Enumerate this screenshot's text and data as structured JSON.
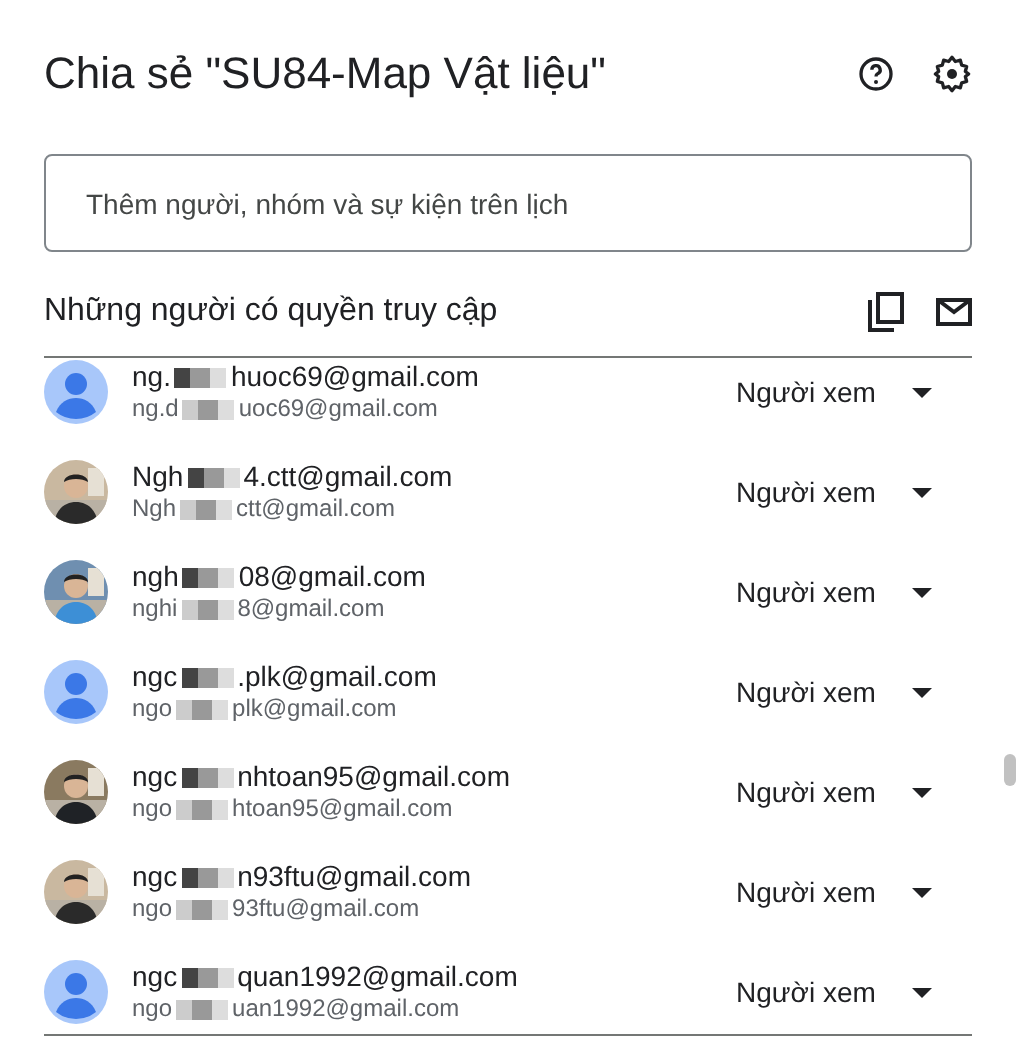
{
  "dialog": {
    "title": "Chia sẻ \"SU84-Map Vật liệu\""
  },
  "add_people": {
    "placeholder": "Thêm người, nhóm và sự kiện trên lịch"
  },
  "access_section": {
    "heading": "Những người có quyền truy cập"
  },
  "people": [
    {
      "kind": "default",
      "name_start": "ng.",
      "name_end": "huoc69@gmail.com",
      "email_start": "ng.d",
      "email_end": "uoc69@gmail.com",
      "role": "Người xem"
    },
    {
      "kind": "picture",
      "name_start": "Ngh",
      "name_end": "4.ctt@gmail.com",
      "email_start": "Ngh",
      "email_end": "ctt@gmail.com",
      "role": "Người xem"
    },
    {
      "kind": "picture",
      "name_start": "ngh",
      "name_end": "08@gmail.com",
      "email_start": "nghi",
      "email_end": "8@gmail.com",
      "role": "Người xem"
    },
    {
      "kind": "default",
      "name_start": "ngc",
      "name_end": ".plk@gmail.com",
      "email_start": "ngo",
      "email_end": "plk@gmail.com",
      "role": "Người xem"
    },
    {
      "kind": "picture",
      "name_start": "ngc",
      "name_end": "nhtoan95@gmail.com",
      "email_start": "ngo",
      "email_end": "htoan95@gmail.com",
      "role": "Người xem"
    },
    {
      "kind": "picture",
      "name_start": "ngc",
      "name_end": "n93ftu@gmail.com",
      "email_start": "ngo",
      "email_end": "93ftu@gmail.com",
      "role": "Người xem"
    },
    {
      "kind": "default",
      "name_start": "ngc",
      "name_end": "quan1992@gmail.com",
      "email_start": "ngo",
      "email_end": "uan1992@gmail.com",
      "role": "Người xem"
    }
  ]
}
